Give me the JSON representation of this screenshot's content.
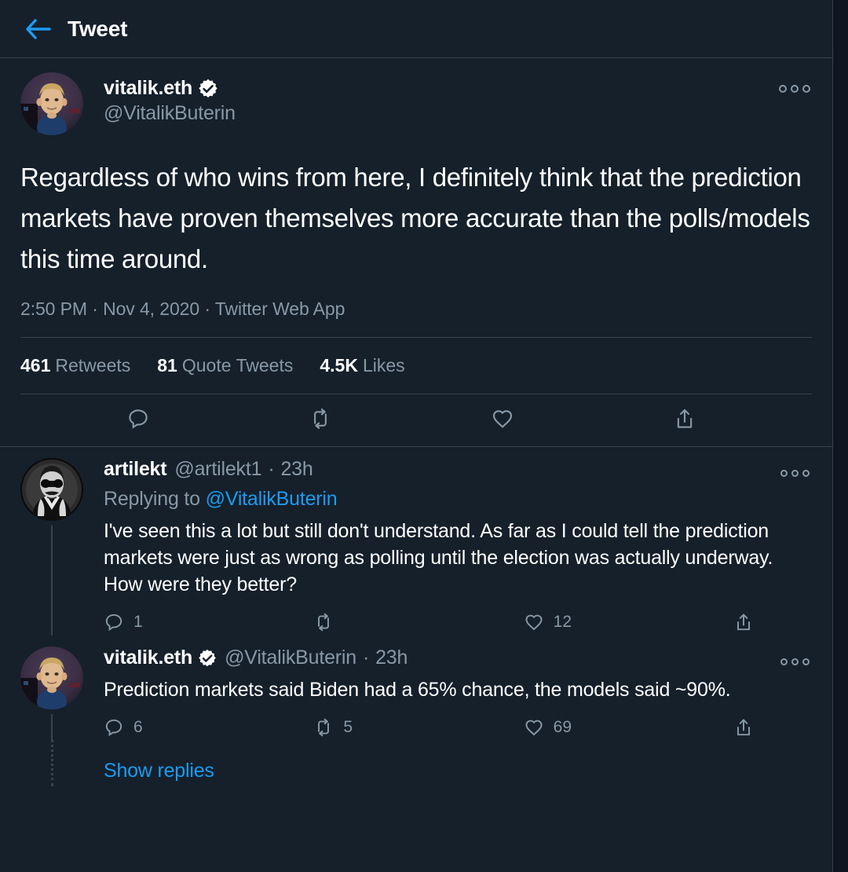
{
  "header": {
    "back_icon": "back-arrow-icon",
    "title": "Tweet",
    "accent_color": "#1D9BF0"
  },
  "theme": {
    "background": "#15202B",
    "outer_background": "#0E1621",
    "border": "#38444D",
    "text_primary": "#FFFFFF",
    "text_secondary": "#8899A6",
    "link": "#1D9BF0"
  },
  "main_tweet": {
    "author": {
      "display_name": "vitalik.eth",
      "handle": "@VitalikButerin",
      "verified": true,
      "avatar_alt": "vitalik-avatar"
    },
    "text": "Regardless of who wins from here, I definitely think that the prediction markets have proven themselves more accurate than the polls/models this time around.",
    "timestamp": "2:50 PM · Nov 4, 2020 · Twitter Web App",
    "stats": [
      {
        "count": "461",
        "label": "Retweets"
      },
      {
        "count": "81",
        "label": "Quote Tweets"
      },
      {
        "count": "4.5K",
        "label": "Likes"
      }
    ],
    "actions": [
      {
        "icon": "reply-icon",
        "count": ""
      },
      {
        "icon": "retweet-icon",
        "count": ""
      },
      {
        "icon": "like-icon",
        "count": ""
      },
      {
        "icon": "share-icon",
        "count": ""
      }
    ],
    "more_icon": "more-options-icon"
  },
  "replies": [
    {
      "author": {
        "display_name": "artilekt",
        "handle": "@artilekt1",
        "verified": false,
        "avatar_alt": "artilekt-avatar"
      },
      "time": "23h",
      "separator": "·",
      "replying_to_label": "Replying to",
      "replying_to_handle": "@VitalikButerin",
      "text": "I've seen this a lot but still don't understand. As far as I could tell the prediction markets were just as wrong as polling until the election was actually underway. How were they better?",
      "actions": [
        {
          "icon": "reply-icon",
          "count": "1"
        },
        {
          "icon": "retweet-icon",
          "count": ""
        },
        {
          "icon": "like-icon",
          "count": "12"
        },
        {
          "icon": "share-icon",
          "count": ""
        }
      ],
      "more_icon": "more-options-icon"
    },
    {
      "author": {
        "display_name": "vitalik.eth",
        "handle": "@VitalikButerin",
        "verified": true,
        "avatar_alt": "vitalik-avatar"
      },
      "time": "23h",
      "separator": "·",
      "replying_to_label": "",
      "replying_to_handle": "",
      "text": "Prediction markets said Biden had a 65% chance, the models said ~90%.",
      "actions": [
        {
          "icon": "reply-icon",
          "count": "6"
        },
        {
          "icon": "retweet-icon",
          "count": "5"
        },
        {
          "icon": "like-icon",
          "count": "69"
        },
        {
          "icon": "share-icon",
          "count": ""
        }
      ],
      "more_icon": "more-options-icon"
    }
  ],
  "show_replies": {
    "label": "Show replies"
  }
}
